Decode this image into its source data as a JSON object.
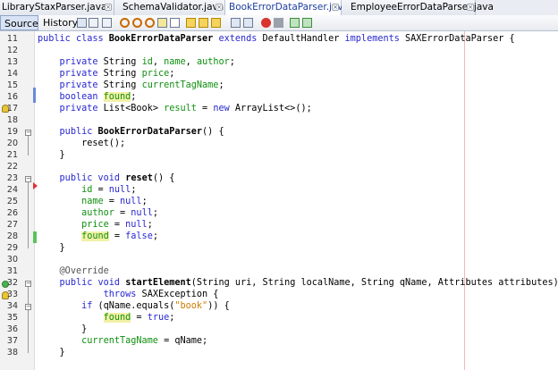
{
  "tabs": [
    {
      "label": "LibraryStaxParser.java",
      "active": false
    },
    {
      "label": "SchemaValidator.java",
      "active": false
    },
    {
      "label": "BookErrorDataParser.java",
      "active": true
    },
    {
      "label": "EmployeeErrorDataParser.java",
      "active": false
    }
  ],
  "toolbar": {
    "source_label": "Source",
    "history_label": "History"
  },
  "code_lines": [
    {
      "num": "11",
      "text": "public class BookErrorDataParser extends DefaultHandler implements SAXErrorDataParser {"
    },
    {
      "num": "12",
      "text": ""
    },
    {
      "num": "13",
      "text": "    private String id, name, author;"
    },
    {
      "num": "14",
      "text": "    private String price;"
    },
    {
      "num": "15",
      "text": "    private String currentTagName;"
    },
    {
      "num": "16",
      "text": "    boolean found;"
    },
    {
      "num": "17",
      "text": "    private List<Book> result = new ArrayList<>();"
    },
    {
      "num": "18",
      "text": ""
    },
    {
      "num": "19",
      "text": "    public BookErrorDataParser() {"
    },
    {
      "num": "20",
      "text": "        reset();"
    },
    {
      "num": "21",
      "text": "    }"
    },
    {
      "num": "22",
      "text": ""
    },
    {
      "num": "23",
      "text": "    public void reset() {"
    },
    {
      "num": "24",
      "text": "        id = null;"
    },
    {
      "num": "25",
      "text": "        name = null;"
    },
    {
      "num": "26",
      "text": "        author = null;"
    },
    {
      "num": "27",
      "text": "        price = null;"
    },
    {
      "num": "28",
      "text": "        found = false;"
    },
    {
      "num": "29",
      "text": "    }"
    },
    {
      "num": "30",
      "text": ""
    },
    {
      "num": "31",
      "text": "    @Override"
    },
    {
      "num": "32",
      "text": "    public void startElement(String uri, String localName, String qName, Attributes attributes)"
    },
    {
      "num": "33",
      "text": "            throws SAXException {"
    },
    {
      "num": "34",
      "text": "        if (qName.equals(\"book\")) {"
    },
    {
      "num": "35",
      "text": "            found = true;"
    },
    {
      "num": "36",
      "text": "        }"
    },
    {
      "num": "37",
      "text": "        currentTagName = qName;"
    },
    {
      "num": "38",
      "text": "    }"
    }
  ],
  "colors": {
    "keyword": "#2727d1",
    "field": "#109010",
    "string": "#ce7b00",
    "highlight": "#f2f0a6"
  }
}
